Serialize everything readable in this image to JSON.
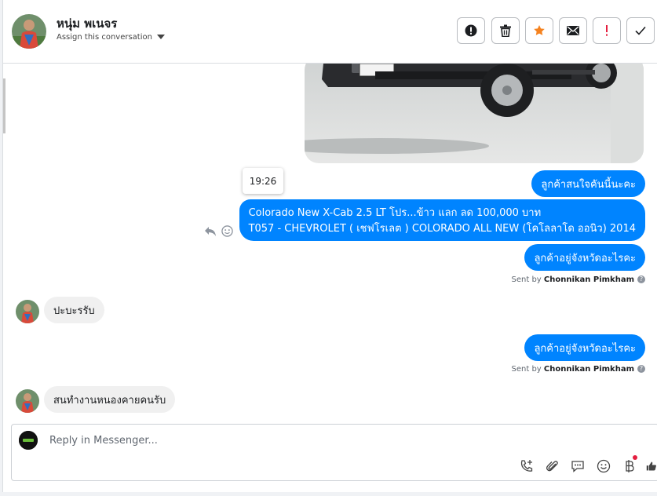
{
  "header": {
    "contact_name": "หนุ่ม พเนจร",
    "assign_label": "Assign this conversation",
    "toolbar": [
      {
        "name": "alert-button",
        "icon": "exclamation-circle-icon"
      },
      {
        "name": "delete-button",
        "icon": "trash-icon"
      },
      {
        "name": "star-button",
        "icon": "star-icon"
      },
      {
        "name": "mark-unread-button",
        "icon": "envelope-icon"
      },
      {
        "name": "spam-button",
        "icon": "exclamation-icon"
      },
      {
        "name": "done-button",
        "icon": "checkmark-icon"
      }
    ]
  },
  "colors": {
    "accent": "#0084ff",
    "star": "#f5821f",
    "spam": "#e41e3f",
    "notification_dot": "#e41e3f"
  },
  "messages": {
    "timestamp_tooltip": "19:26",
    "out_1": "ลูกค้าสนใจคันนี้นะคะ",
    "out_2_line1": "Colorado New X-Cab 2.5 LT โปร...ข้าว แลก ลด 100,000 บาท",
    "out_2_line2": "T057 - CHEVROLET ( เชฟโรเลต ) COLORADO ALL NEW (โคโลลาโด ออนิว) 2014",
    "out_3": "ลูกค้าอยู่จังหวัดอะไรคะ",
    "sent_by_prefix": "Sent by",
    "sent_by_name": "Chonnikan Pimkham",
    "in_1": "ปะบะรรับ",
    "out_4": "ลูกค้าอยู่จังหวัดอะไรคะ",
    "in_2": "สนทำงานหนองคายคนรับ"
  },
  "composer": {
    "placeholder": "Reply in Messenger...",
    "icons": [
      "phone-add-icon",
      "paperclip-icon",
      "chat-bubble-icon",
      "smiley-icon",
      "baht-icon",
      "thumbs-up-icon"
    ]
  }
}
